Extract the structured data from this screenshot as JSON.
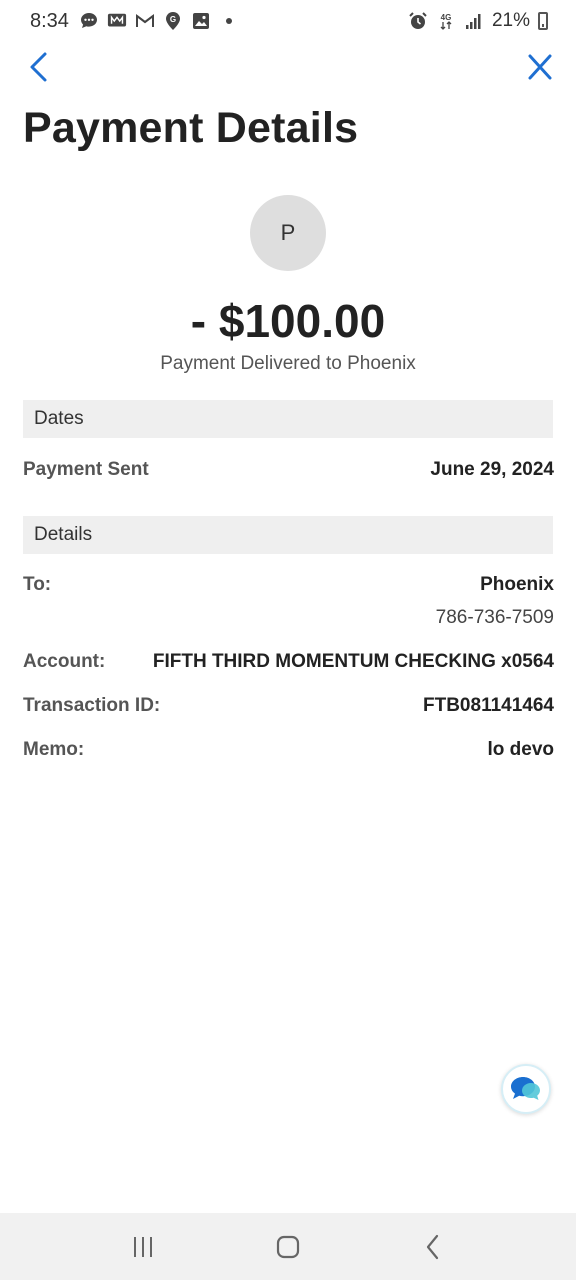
{
  "status_bar": {
    "time": "8:34",
    "battery": "21%",
    "icons_left": [
      "messages-icon",
      "m-app-icon",
      "gmail-icon",
      "location-icon",
      "gallery-icon",
      "dot-icon"
    ],
    "icons_right": [
      "alarm-icon",
      "data-icon",
      "signal-icon",
      "battery-icon"
    ]
  },
  "header": {
    "title": "Payment Details",
    "back_icon": "chevron-left-icon",
    "close_icon": "close-icon",
    "accent_color": "#1f6fd1"
  },
  "payee": {
    "avatar_initial": "P",
    "amount": "- $100.00",
    "status_text": "Payment Delivered to Phoenix"
  },
  "dates_section": {
    "heading": "Dates",
    "payment_sent_label": "Payment Sent",
    "payment_sent_value": "June 29, 2024"
  },
  "details_section": {
    "heading": "Details",
    "to_label": "To:",
    "to_value": "Phoenix",
    "to_phone": "786-736-7509",
    "account_label": "Account:",
    "account_value": "FIFTH THIRD MOMENTUM CHECKING x0564",
    "transaction_label": "Transaction ID:",
    "transaction_value": "FTB081141464",
    "memo_label": "Memo:",
    "memo_value": "lo devo"
  },
  "chat": {
    "icon": "chat-bubble-icon"
  },
  "system_nav": {
    "recents": "recents-icon",
    "home": "home-icon",
    "back": "back-icon"
  }
}
